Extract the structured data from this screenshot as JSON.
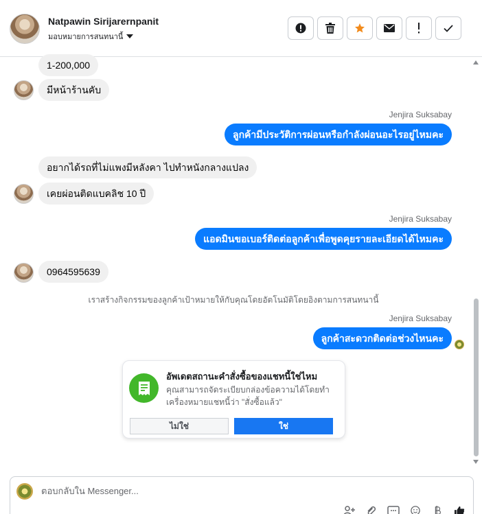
{
  "header": {
    "contact_name": "Natpawin Sirijarernpanit",
    "assign_label": "มอบหมายการสนทนานี้",
    "actions": [
      {
        "icon": "alert-circle-icon",
        "name": "mark-spam-button"
      },
      {
        "icon": "trash-icon",
        "name": "delete-button"
      },
      {
        "icon": "star-icon",
        "name": "star-button"
      },
      {
        "icon": "envelope-icon",
        "name": "mark-unread-button"
      },
      {
        "icon": "exclamation-icon",
        "name": "follow-up-button"
      },
      {
        "icon": "check-icon",
        "name": "mark-done-button"
      }
    ],
    "star_color": "#f28b1c"
  },
  "messages": {
    "m1": "1-200,000",
    "m2": "มีหน้าร้านคับ",
    "s1": "Jenjira Suksabay",
    "m3": "ลูกค้ามีประวัติการผ่อนหรือกำลังผ่อนอะไรอยู่ไหมคะ",
    "m4": "อยากได้รถที่ไม่แพงมีหลังคา ไปทำหนังกลางแปลง",
    "m5": "เคยผ่อนติดแบคลิช 10 ปี",
    "s2": "Jenjira Suksabay",
    "m6": "แอดมินขอเบอร์ติดต่อลูกค้าเพื่อพูดคุยรายละเอียดได้ไหมคะ",
    "m7": "0964595639",
    "system": "เราสร้างกิจกรรมของลูกค้าเป้าหมายให้กับคุณโดยอัตโนมัติโดยอิงตามการสนทนานี้",
    "s3": "Jenjira Suksabay",
    "m8": "ลูกค้าสะดวกติดต่อช่วงไหนคะ"
  },
  "card": {
    "title": "อัพเดตสถานะคำสั่งซื้อของแชทนี้ใช่ไหม",
    "description": "คุณสามารถจัดระเบียบกล่องข้อความได้โดยทำเครื่องหมายแชทนี้ว่า \"สั่งซื้อแล้ว\"",
    "no_label": "ไม่ใช่",
    "yes_label": "ใช่",
    "icon": "receipt-icon"
  },
  "composer": {
    "placeholder": "ตอบกลับใน Messenger...",
    "tools": [
      "add-person-icon",
      "attachment-icon",
      "saved-reply-icon",
      "emoji-icon",
      "payment-icon",
      "like-icon"
    ]
  },
  "colors": {
    "outgoing_bubble": "#0a7cff",
    "incoming_bubble": "#f0f0f0",
    "card_icon_bg": "#42b72a",
    "primary_button": "#1877f2"
  }
}
